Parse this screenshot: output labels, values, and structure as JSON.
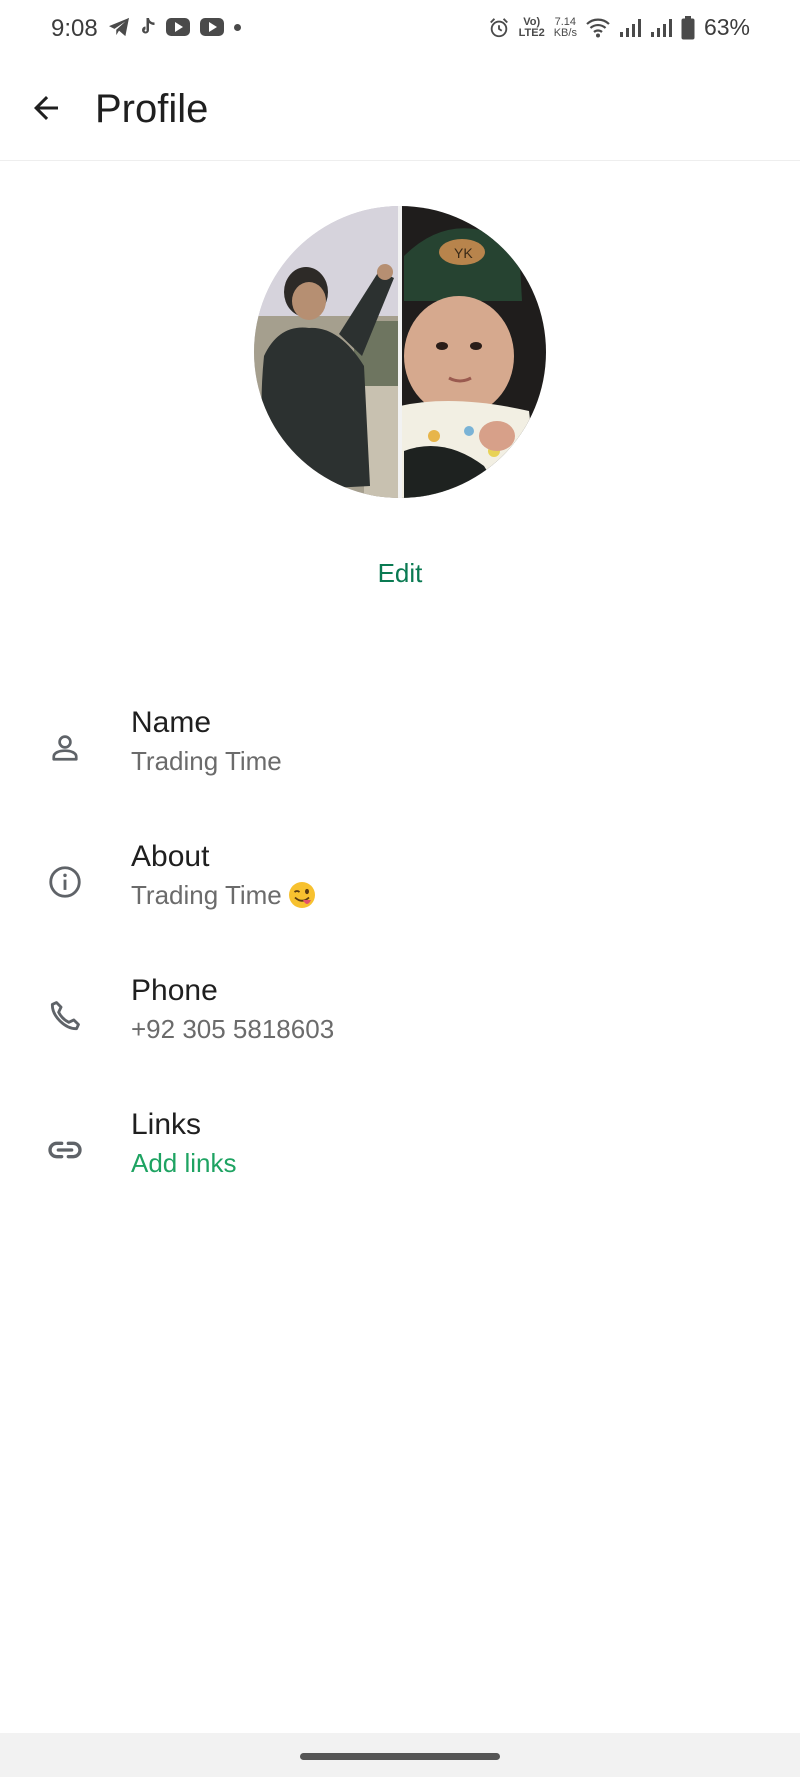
{
  "status_bar": {
    "time": "9:08",
    "speed_value": "7.14",
    "speed_unit": "KB/s",
    "volte_top": "Vo)",
    "volte_bottom": "LTE2",
    "battery": "63%",
    "left_icons": [
      "telegram-icon",
      "tiktok-icon",
      "youtube-icon",
      "youtube-icon",
      "dot-icon"
    ],
    "right_icons": [
      "alarm-icon",
      "volte-icon",
      "wifi-icon",
      "signal-icon",
      "signal-icon",
      "battery-icon"
    ]
  },
  "app_bar": {
    "title": "Profile",
    "back_icon": "arrow-back-icon"
  },
  "profile": {
    "edit_label": "Edit"
  },
  "rows": [
    {
      "icon": "person-icon",
      "label": "Name",
      "value": "Trading Time"
    },
    {
      "icon": "info-icon",
      "label": "About",
      "value": "Trading Time",
      "emoji": "winking-tongue-emoji"
    },
    {
      "icon": "phone-icon",
      "label": "Phone",
      "value": "+92 305 5818603"
    },
    {
      "icon": "link-icon",
      "label": "Links",
      "value": "Add links"
    }
  ],
  "colors": {
    "accent_green": "#1ea362",
    "edit_green": "#0a7a52",
    "text_primary": "#1f1f1f",
    "text_secondary": "#6b6b6b",
    "icon_gray": "#5f6368"
  }
}
